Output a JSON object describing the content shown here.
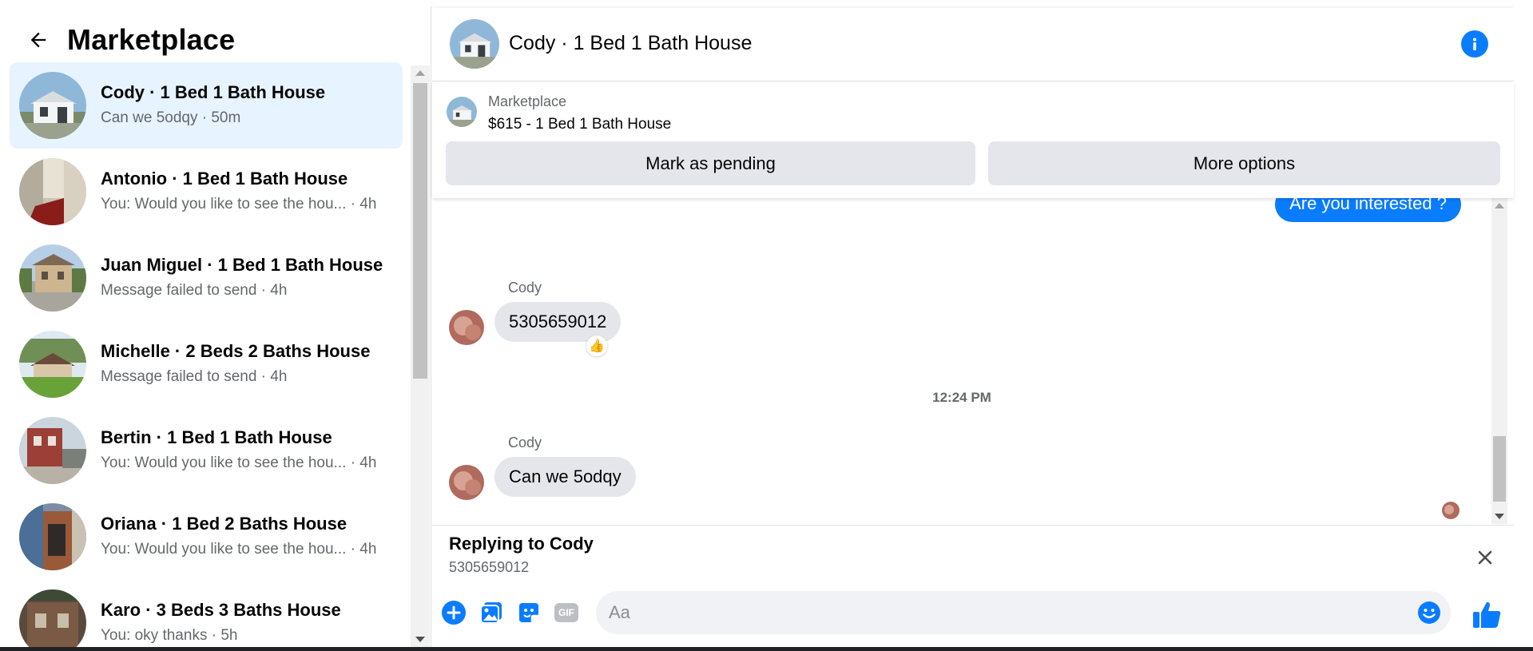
{
  "left": {
    "title": "Marketplace",
    "conversations": [
      {
        "title": "Cody · 1 Bed 1 Bath House",
        "subtitle": "Can we 5odqy · 50m",
        "active": true
      },
      {
        "title": "Antonio · 1 Bed 1 Bath House",
        "subtitle": "You: Would you like to see the hou... · 4h"
      },
      {
        "title": "Juan Miguel · 1 Bed 1 Bath House",
        "subtitle": "Message failed to send · 4h"
      },
      {
        "title": "Michelle · 2 Beds 2 Baths House",
        "subtitle": "Message failed to send · 4h"
      },
      {
        "title": "Bertin · 1 Bed 1 Bath House",
        "subtitle": "You: Would you like to see the hou... · 4h"
      },
      {
        "title": "Oriana · 1 Bed 2 Baths House",
        "subtitle": "You: Would you like to see the hou... · 4h"
      },
      {
        "title": "Karo · 3 Beds 3 Baths House",
        "subtitle": "You: oky thanks · 5h"
      }
    ]
  },
  "chat": {
    "header_title": "Cody · 1 Bed 1 Bath House",
    "listing": {
      "label": "Marketplace",
      "price_title": "$615 - 1 Bed 1 Bath House",
      "pending_button": "Mark as pending",
      "more_button": "More options"
    },
    "messages": {
      "outgoing_text": "Are you interested ?",
      "msg1_sender": "Cody",
      "msg1_text": "5305659012",
      "msg1_reaction": "👍",
      "timestamp": "12:24 PM",
      "msg2_sender": "Cody",
      "msg2_text": "Can we 5odqy"
    },
    "reply": {
      "title": "Replying to Cody",
      "quoted": "5305659012"
    },
    "composer": {
      "placeholder": "Aa",
      "gif_label": "GIF"
    }
  },
  "colors": {
    "accent": "#0a7cff",
    "active_row": "#e7f3ff",
    "bubble_in": "#e4e6eb"
  }
}
